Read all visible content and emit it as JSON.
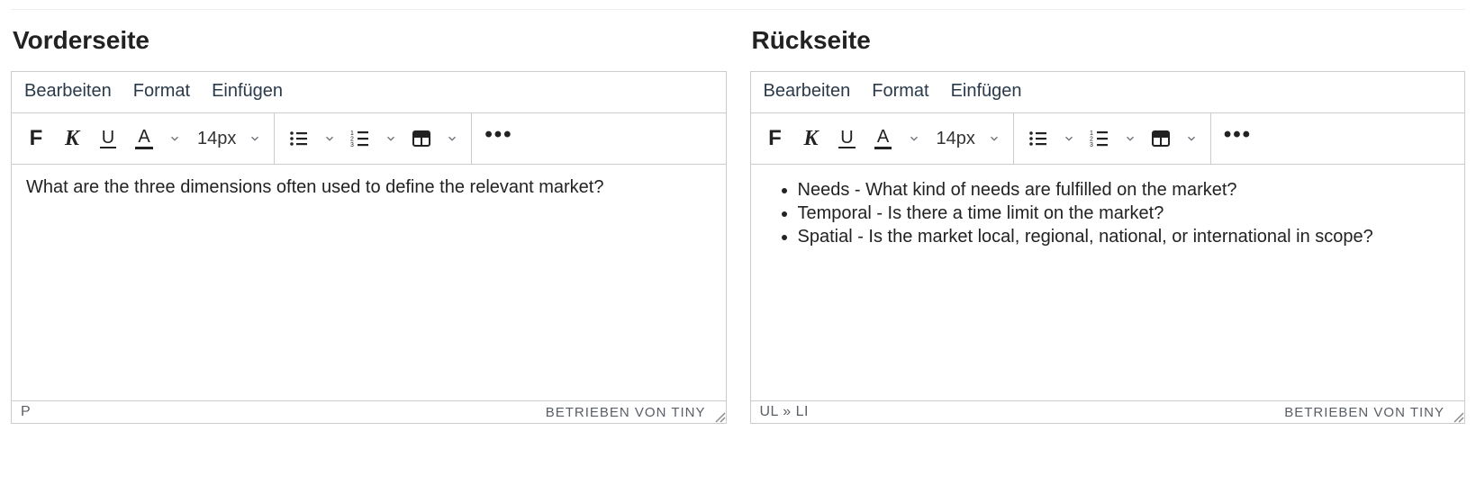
{
  "front": {
    "title": "Vorderseite",
    "menubar": {
      "edit": "Bearbeiten",
      "format": "Format",
      "insert": "Einfügen"
    },
    "toolbar": {
      "bold": "F",
      "italic": "K",
      "underline": "U",
      "textcolor": "A",
      "fontsize": "14px"
    },
    "content_text": "What are the three dimensions often used to define the relevant market?",
    "status_path": "P",
    "status_brand": "BETRIEBEN VON TINY"
  },
  "back": {
    "title": "Rückseite",
    "menubar": {
      "edit": "Bearbeiten",
      "format": "Format",
      "insert": "Einfügen"
    },
    "toolbar": {
      "bold": "F",
      "italic": "K",
      "underline": "U",
      "textcolor": "A",
      "fontsize": "14px"
    },
    "content_items": [
      "Needs - What kind of needs are fulfilled on the market?",
      "Temporal - Is there a time limit on the market?",
      "Spatial - Is the market local, regional, national, or international in scope?"
    ],
    "status_path": "UL » LI",
    "status_brand": "BETRIEBEN VON TINY"
  }
}
